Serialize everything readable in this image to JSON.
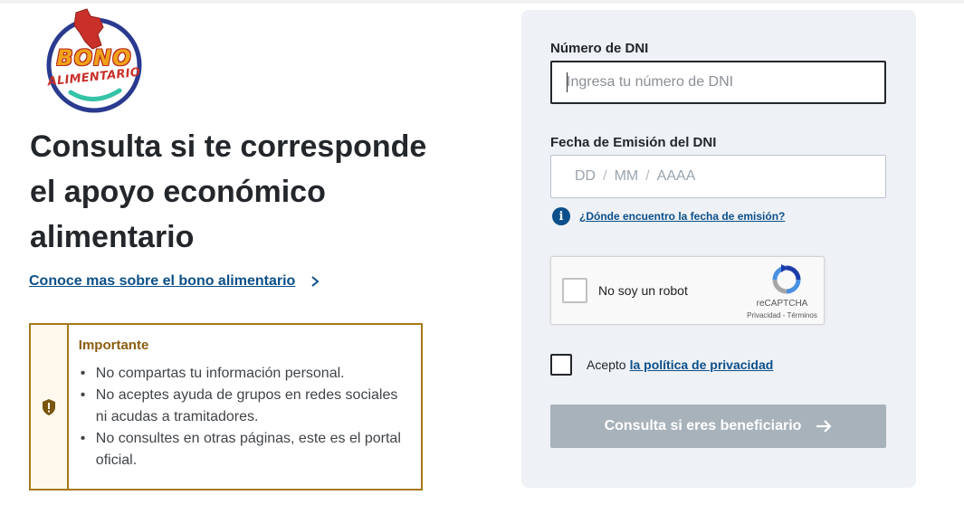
{
  "logo": {
    "line1": "BONO",
    "line2": "ALIMENTARIO"
  },
  "heading": "Consulta si te corresponde el apoyo económico alimentario",
  "learn_more_link": "Conoce mas sobre el bono alimentario",
  "important": {
    "title": "Importante",
    "items": [
      "No compartas tu información personal.",
      "No aceptes ayuda de grupos en redes sociales ni acudas a tramitadores.",
      "No consultes en otras páginas, este es el portal oficial."
    ]
  },
  "form": {
    "dni_label": "Número de DNI",
    "dni_placeholder": "Ingresa tu número de DNI",
    "date_label": "Fecha de Emisión del DNI",
    "date_dd": "DD",
    "date_mm": "MM",
    "date_yyyy": "AAAA",
    "date_separator": "/",
    "date_help_link": "¿Dónde encuentro la fecha de emisión?",
    "recaptcha": {
      "label": "No soy un robot",
      "brand": "reCAPTCHA",
      "terms": "Privacidad - Términos"
    },
    "privacy_prefix": "Acepto",
    "privacy_link": "la política de privacidad",
    "submit_label": "Consulta si eres beneficiario"
  },
  "colors": {
    "link_blue": "#0b4f8a",
    "card_bg": "#eef1f5",
    "important_border": "#a7781a",
    "important_title": "#8a5e10",
    "submit_disabled": "#a7b2ba"
  }
}
